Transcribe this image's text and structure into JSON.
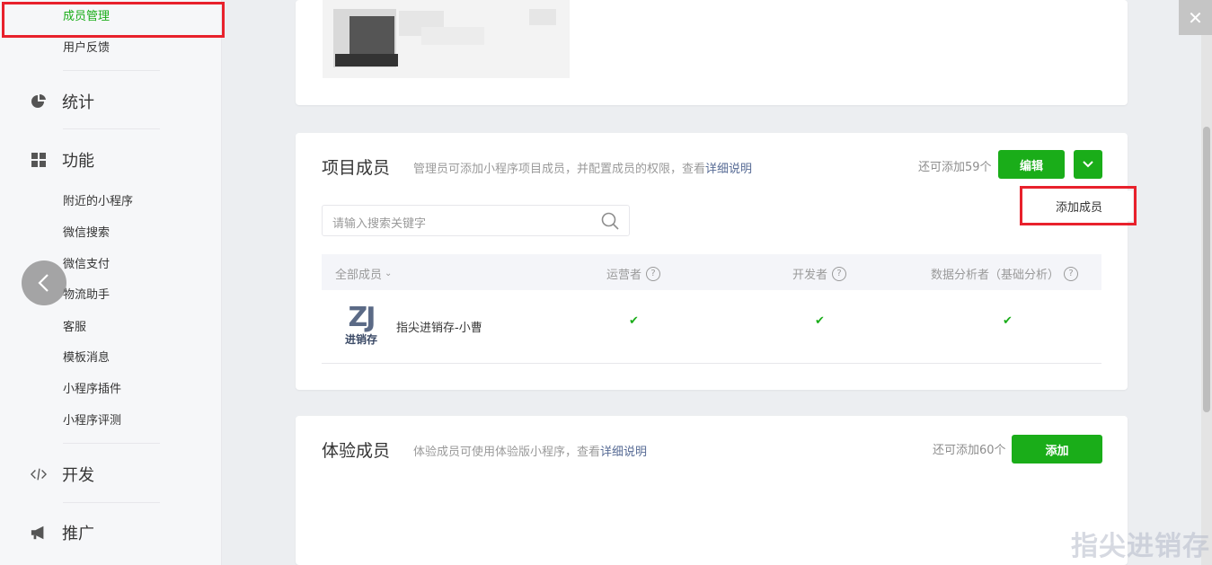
{
  "sidebar": {
    "sub_top": [
      {
        "label": "成员管理",
        "active": true
      },
      {
        "label": "用户反馈",
        "active": false
      }
    ],
    "stats_label": "统计",
    "features_label": "功能",
    "feature_items": [
      "附近的小程序",
      "微信搜索",
      "微信支付",
      "物流助手",
      "客服",
      "模板消息",
      "小程序插件",
      "小程序评测"
    ],
    "develop_label": "开发",
    "promote_label": "推广"
  },
  "project_members": {
    "title": "项目成员",
    "desc_prefix": "管理员可添加小程序项目成员，并配置成员的权限，查看",
    "desc_link": "详细说明",
    "quota": "还可添加59个",
    "edit_button": "编辑",
    "dropdown_item": "添加成员",
    "search_placeholder": "请输入搜索关键字",
    "columns": {
      "all": "全部成员",
      "operator": "运营者",
      "developer": "开发者",
      "analyst": "数据分析者（基础分析）"
    },
    "rows": [
      {
        "name": "指尖进销存-小曹",
        "avatar_text_top": "ZJ",
        "avatar_text_bottom": "进销存",
        "operator": "✔",
        "developer": "✔",
        "analyst": "✔"
      }
    ]
  },
  "trial_members": {
    "title": "体验成员",
    "desc_prefix": "体验成员可使用体验版小程序，查看",
    "desc_link": "详细说明",
    "quota": "还可添加60个",
    "add_button": "添加"
  },
  "watermark": "指尖进销存",
  "colors": {
    "accent": "#1aad19",
    "highlight": "#e8212c",
    "link": "#576b95"
  }
}
